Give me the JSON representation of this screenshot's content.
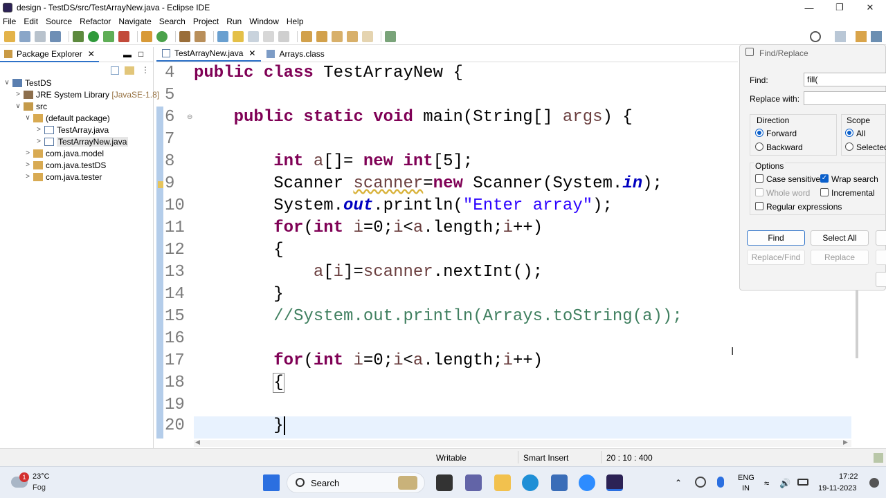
{
  "window": {
    "title": "design - TestDS/src/TestArrayNew.java - Eclipse IDE"
  },
  "menu": [
    "File",
    "Edit",
    "Source",
    "Refactor",
    "Navigate",
    "Search",
    "Project",
    "Run",
    "Window",
    "Help"
  ],
  "package_explorer": {
    "tab_label": "Package Explorer",
    "items": [
      {
        "label": "TestDS"
      },
      {
        "label": "JRE System Library",
        "suffix": "[JavaSE-1.8]"
      },
      {
        "label": "src"
      },
      {
        "label": "(default package)"
      },
      {
        "label": "TestArray.java"
      },
      {
        "label": "TestArrayNew.java"
      },
      {
        "label": "com.java.model"
      },
      {
        "label": "com.java.testDS"
      },
      {
        "label": "com.java.tester"
      }
    ]
  },
  "editor": {
    "tabs": [
      {
        "label": "TestArrayNew.java"
      },
      {
        "label": "Arrays.class"
      }
    ],
    "line_numbers": [
      "4",
      "5",
      "6",
      "7",
      "8",
      "9",
      "10",
      "11",
      "12",
      "13",
      "14",
      "15",
      "16",
      "17",
      "18",
      "19",
      "20"
    ]
  },
  "find_replace": {
    "title": "Find/Replace",
    "find_label": "Find:",
    "find_value": "fill(",
    "replace_label": "Replace with:",
    "replace_value": "",
    "direction_label": "Direction",
    "forward": "Forward",
    "backward": "Backward",
    "scope_label": "Scope",
    "scope_all": "All",
    "scope_selected": "Selected",
    "options_label": "Options",
    "case_sensitive": "Case sensitive",
    "wrap_search": "Wrap search",
    "whole_word": "Whole word",
    "incremental": "Incremental",
    "regex": "Regular expressions",
    "btn_find": "Find",
    "btn_select_all": "Select All",
    "btn_replace_find": "Replace/Find",
    "btn_replace": "Replace"
  },
  "status": {
    "writable": "Writable",
    "insert_mode": "Smart Insert",
    "position": "20 : 10 : 400"
  },
  "taskbar": {
    "weather_temp": "23°C",
    "weather_desc": "Fog",
    "weather_badge": "1",
    "search_label": "Search",
    "lang_line1": "ENG",
    "lang_line2": "IN",
    "time": "17:22",
    "date": "19-11-2023"
  }
}
